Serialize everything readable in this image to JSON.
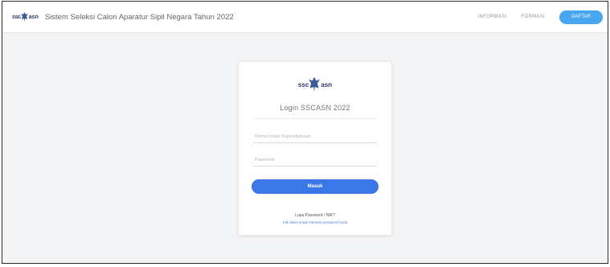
{
  "header": {
    "brand_logo_text": "ssc asn",
    "title": "Sistem Seleksi Calon Aparatur Sipil Negara Tahun 2022",
    "nav_items": [
      {
        "label": "INFORMASI"
      },
      {
        "label": "FORMASI"
      }
    ],
    "register_label": "DAFTAR"
  },
  "login": {
    "logo_text": "ssc asn",
    "title": "Login SSCASN 2022",
    "nik_placeholder": "Nomor Induk Kependudukan",
    "password_placeholder": "Password",
    "submit_label": "Masuk",
    "forgot_title": "Lupa Password / NIK?",
    "forgot_link": "Klik disini untuk mereset password Anda"
  },
  "colors": {
    "accent_blue": "#3b78e7",
    "register_blue": "#46a6f2",
    "page_background": "#f3f4f6"
  }
}
